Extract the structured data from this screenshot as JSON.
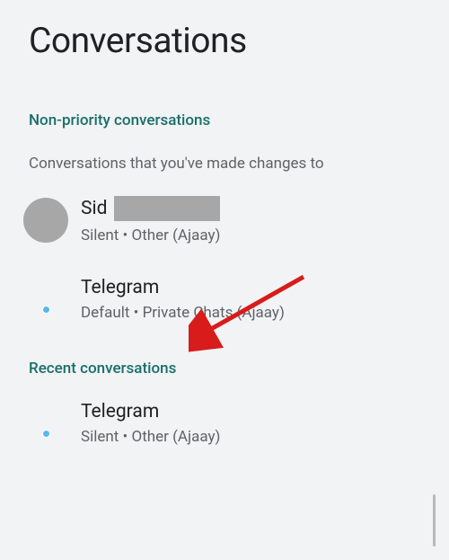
{
  "header": {
    "title": "Conversations"
  },
  "sections": {
    "nonPriority": {
      "label": "Non-priority conversations",
      "description": "Conversations that you've made changes to",
      "items": [
        {
          "title": "Sid",
          "subtitle": "Silent • Other (Ajaay)"
        },
        {
          "title": "Telegram",
          "subtitle": "Default • Private Chats (Ajaay)"
        }
      ]
    },
    "recent": {
      "label": "Recent conversations",
      "items": [
        {
          "title": "Telegram",
          "subtitle": "Silent • Other (Ajaay)"
        }
      ]
    }
  }
}
